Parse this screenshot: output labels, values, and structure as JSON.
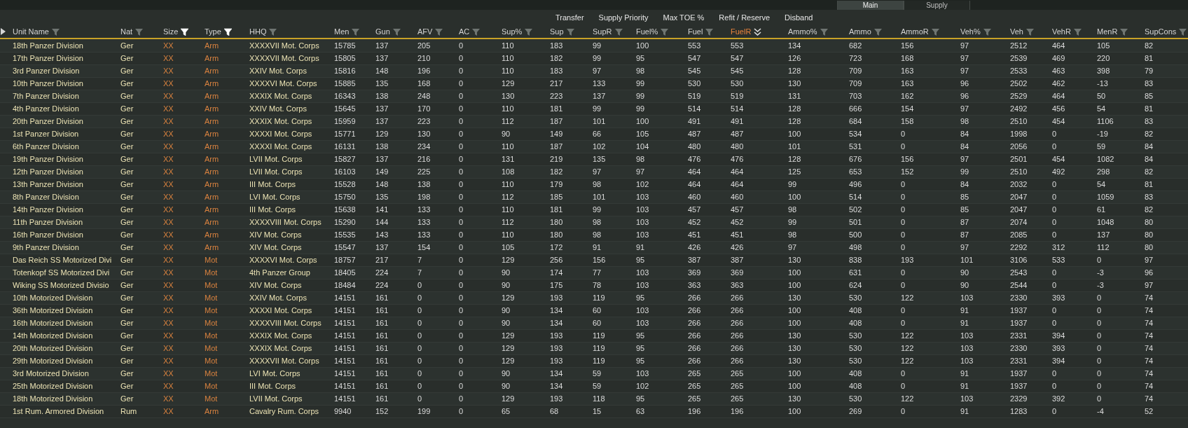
{
  "tabs": [
    {
      "label": "Main",
      "selected": true
    },
    {
      "label": "Supply",
      "selected": false
    }
  ],
  "actions": [
    "Transfer",
    "Supply Priority",
    "Max TOE %",
    "Refit / Reserve",
    "Disband"
  ],
  "columns": [
    {
      "label": "Unit Name",
      "kind": "name",
      "filter_active": false,
      "sorted": false
    },
    {
      "label": "Nat",
      "kind": "text",
      "filter_active": false,
      "sorted": false
    },
    {
      "label": "Size",
      "kind": "tag",
      "filter_active": true,
      "sorted": false
    },
    {
      "label": "Type",
      "kind": "tag",
      "filter_active": true,
      "sorted": false
    },
    {
      "label": "HHQ",
      "kind": "text",
      "filter_active": false,
      "sorted": false
    },
    {
      "label": "Men",
      "kind": "number",
      "filter_active": false,
      "sorted": false
    },
    {
      "label": "Gun",
      "kind": "number",
      "filter_active": false,
      "sorted": false
    },
    {
      "label": "AFV",
      "kind": "number",
      "filter_active": false,
      "sorted": false
    },
    {
      "label": "AC",
      "kind": "number",
      "filter_active": false,
      "sorted": false
    },
    {
      "label": "Sup%",
      "kind": "number",
      "filter_active": false,
      "sorted": false
    },
    {
      "label": "Sup",
      "kind": "number",
      "filter_active": false,
      "sorted": false
    },
    {
      "label": "SupR",
      "kind": "number",
      "filter_active": false,
      "sorted": false
    },
    {
      "label": "Fuel%",
      "kind": "number",
      "filter_active": false,
      "sorted": false
    },
    {
      "label": "Fuel",
      "kind": "number",
      "filter_active": false,
      "sorted": false
    },
    {
      "label": "FuelR",
      "kind": "number",
      "sorted": true
    },
    {
      "label": "Ammo%",
      "kind": "number",
      "filter_active": false,
      "sorted": false
    },
    {
      "label": "Ammo",
      "kind": "number",
      "filter_active": false,
      "sorted": false
    },
    {
      "label": "AmmoR",
      "kind": "number",
      "filter_active": false,
      "sorted": false
    },
    {
      "label": "Veh%",
      "kind": "number",
      "filter_active": false,
      "sorted": false
    },
    {
      "label": "Veh",
      "kind": "number",
      "filter_active": false,
      "sorted": false
    },
    {
      "label": "VehR",
      "kind": "number",
      "filter_active": false,
      "sorted": false
    },
    {
      "label": "MenR",
      "kind": "number",
      "filter_active": false,
      "sorted": false
    },
    {
      "label": "SupCons",
      "kind": "number",
      "filter_active": false,
      "sorted": false
    }
  ],
  "rows": [
    [
      "18th Panzer Division",
      "Ger",
      "XX",
      "Arm",
      "XXXXVII Mot. Corps",
      "15785",
      "137",
      "205",
      "0",
      "110",
      "183",
      "99",
      "100",
      "553",
      "553",
      "134",
      "682",
      "156",
      "97",
      "2512",
      "464",
      "105",
      "82"
    ],
    [
      "17th Panzer Division",
      "Ger",
      "XX",
      "Arm",
      "XXXXVII Mot. Corps",
      "15805",
      "137",
      "210",
      "0",
      "110",
      "182",
      "99",
      "95",
      "547",
      "547",
      "126",
      "723",
      "168",
      "97",
      "2539",
      "469",
      "220",
      "81"
    ],
    [
      "3rd Panzer Division",
      "Ger",
      "XX",
      "Arm",
      "XXIV Mot. Corps",
      "15816",
      "148",
      "196",
      "0",
      "110",
      "183",
      "97",
      "98",
      "545",
      "545",
      "128",
      "709",
      "163",
      "97",
      "2533",
      "463",
      "398",
      "79"
    ],
    [
      "10th Panzer Division",
      "Ger",
      "XX",
      "Arm",
      "XXXXVI Mot. Corps",
      "15885",
      "135",
      "168",
      "0",
      "129",
      "217",
      "133",
      "99",
      "530",
      "530",
      "130",
      "709",
      "163",
      "96",
      "2502",
      "462",
      "-13",
      "83"
    ],
    [
      "7th Panzer Division",
      "Ger",
      "XX",
      "Arm",
      "XXXIX Mot. Corps",
      "16343",
      "138",
      "248",
      "0",
      "130",
      "223",
      "137",
      "99",
      "519",
      "519",
      "131",
      "703",
      "162",
      "96",
      "2529",
      "464",
      "50",
      "85"
    ],
    [
      "4th Panzer Division",
      "Ger",
      "XX",
      "Arm",
      "XXIV Mot. Corps",
      "15645",
      "137",
      "170",
      "0",
      "110",
      "181",
      "99",
      "99",
      "514",
      "514",
      "128",
      "666",
      "154",
      "97",
      "2492",
      "456",
      "54",
      "81"
    ],
    [
      "20th Panzer Division",
      "Ger",
      "XX",
      "Arm",
      "XXXIX Mot. Corps",
      "15959",
      "137",
      "223",
      "0",
      "112",
      "187",
      "101",
      "100",
      "491",
      "491",
      "128",
      "684",
      "158",
      "98",
      "2510",
      "454",
      "1106",
      "83"
    ],
    [
      "1st Panzer Division",
      "Ger",
      "XX",
      "Arm",
      "XXXXI Mot. Corps",
      "15771",
      "129",
      "130",
      "0",
      "90",
      "149",
      "66",
      "105",
      "487",
      "487",
      "100",
      "534",
      "0",
      "84",
      "1998",
      "0",
      "-19",
      "82"
    ],
    [
      "6th Panzer Division",
      "Ger",
      "XX",
      "Arm",
      "XXXXI Mot. Corps",
      "16131",
      "138",
      "234",
      "0",
      "110",
      "187",
      "102",
      "104",
      "480",
      "480",
      "101",
      "531",
      "0",
      "84",
      "2056",
      "0",
      "59",
      "84"
    ],
    [
      "19th Panzer Division",
      "Ger",
      "XX",
      "Arm",
      "LVII Mot. Corps",
      "15827",
      "137",
      "216",
      "0",
      "131",
      "219",
      "135",
      "98",
      "476",
      "476",
      "128",
      "676",
      "156",
      "97",
      "2501",
      "454",
      "1082",
      "84"
    ],
    [
      "12th Panzer Division",
      "Ger",
      "XX",
      "Arm",
      "LVII Mot. Corps",
      "16103",
      "149",
      "225",
      "0",
      "108",
      "182",
      "97",
      "97",
      "464",
      "464",
      "125",
      "653",
      "152",
      "99",
      "2510",
      "492",
      "298",
      "82"
    ],
    [
      "13th Panzer Division",
      "Ger",
      "XX",
      "Arm",
      "III Mot. Corps",
      "15528",
      "148",
      "138",
      "0",
      "110",
      "179",
      "98",
      "102",
      "464",
      "464",
      "99",
      "496",
      "0",
      "84",
      "2032",
      "0",
      "54",
      "81"
    ],
    [
      "8th Panzer Division",
      "Ger",
      "XX",
      "Arm",
      "LVI Mot. Corps",
      "15750",
      "135",
      "198",
      "0",
      "112",
      "185",
      "101",
      "103",
      "460",
      "460",
      "100",
      "514",
      "0",
      "85",
      "2047",
      "0",
      "1059",
      "83"
    ],
    [
      "14th Panzer Division",
      "Ger",
      "XX",
      "Arm",
      "III Mot. Corps",
      "15638",
      "141",
      "133",
      "0",
      "110",
      "181",
      "99",
      "103",
      "457",
      "457",
      "98",
      "502",
      "0",
      "85",
      "2047",
      "0",
      "61",
      "82"
    ],
    [
      "11th Panzer Division",
      "Ger",
      "XX",
      "Arm",
      "XXXXVIII Mot. Corps",
      "15290",
      "144",
      "133",
      "0",
      "112",
      "180",
      "98",
      "103",
      "452",
      "452",
      "99",
      "501",
      "0",
      "87",
      "2074",
      "0",
      "1048",
      "80"
    ],
    [
      "16th Panzer Division",
      "Ger",
      "XX",
      "Arm",
      "XIV Mot. Corps",
      "15535",
      "143",
      "133",
      "0",
      "110",
      "180",
      "98",
      "103",
      "451",
      "451",
      "98",
      "500",
      "0",
      "87",
      "2085",
      "0",
      "137",
      "80"
    ],
    [
      "9th Panzer Division",
      "Ger",
      "XX",
      "Arm",
      "XIV Mot. Corps",
      "15547",
      "137",
      "154",
      "0",
      "105",
      "172",
      "91",
      "91",
      "426",
      "426",
      "97",
      "498",
      "0",
      "97",
      "2292",
      "312",
      "112",
      "80"
    ],
    [
      "Das Reich SS Motorized Divi",
      "Ger",
      "XX",
      "Mot",
      "XXXXVI Mot. Corps",
      "18757",
      "217",
      "7",
      "0",
      "129",
      "256",
      "156",
      "95",
      "387",
      "387",
      "130",
      "838",
      "193",
      "101",
      "3106",
      "533",
      "0",
      "97"
    ],
    [
      "Totenkopf SS Motorized Divi",
      "Ger",
      "XX",
      "Mot",
      "4th Panzer Group",
      "18405",
      "224",
      "7",
      "0",
      "90",
      "174",
      "77",
      "103",
      "369",
      "369",
      "100",
      "631",
      "0",
      "90",
      "2543",
      "0",
      "-3",
      "96"
    ],
    [
      "Wiking SS Motorized Divisio",
      "Ger",
      "XX",
      "Mot",
      "XIV Mot. Corps",
      "18484",
      "224",
      "0",
      "0",
      "90",
      "175",
      "78",
      "103",
      "363",
      "363",
      "100",
      "624",
      "0",
      "90",
      "2544",
      "0",
      "-3",
      "97"
    ],
    [
      "10th Motorized Division",
      "Ger",
      "XX",
      "Mot",
      "XXIV Mot. Corps",
      "14151",
      "161",
      "0",
      "0",
      "129",
      "193",
      "119",
      "95",
      "266",
      "266",
      "130",
      "530",
      "122",
      "103",
      "2330",
      "393",
      "0",
      "74"
    ],
    [
      "36th Motorized Division",
      "Ger",
      "XX",
      "Mot",
      "XXXXI Mot. Corps",
      "14151",
      "161",
      "0",
      "0",
      "90",
      "134",
      "60",
      "103",
      "266",
      "266",
      "100",
      "408",
      "0",
      "91",
      "1937",
      "0",
      "0",
      "74"
    ],
    [
      "16th Motorized Division",
      "Ger",
      "XX",
      "Mot",
      "XXXXVIII Mot. Corps",
      "14151",
      "161",
      "0",
      "0",
      "90",
      "134",
      "60",
      "103",
      "266",
      "266",
      "100",
      "408",
      "0",
      "91",
      "1937",
      "0",
      "0",
      "74"
    ],
    [
      "14th Motorized Division",
      "Ger",
      "XX",
      "Mot",
      "XXXIX Mot. Corps",
      "14151",
      "161",
      "0",
      "0",
      "129",
      "193",
      "119",
      "95",
      "266",
      "266",
      "130",
      "530",
      "122",
      "103",
      "2331",
      "394",
      "0",
      "74"
    ],
    [
      "20th Motorized Division",
      "Ger",
      "XX",
      "Mot",
      "XXXIX Mot. Corps",
      "14151",
      "161",
      "0",
      "0",
      "129",
      "193",
      "119",
      "95",
      "266",
      "266",
      "130",
      "530",
      "122",
      "103",
      "2330",
      "393",
      "0",
      "74"
    ],
    [
      "29th Motorized Division",
      "Ger",
      "XX",
      "Mot",
      "XXXXVII Mot. Corps",
      "14151",
      "161",
      "0",
      "0",
      "129",
      "193",
      "119",
      "95",
      "266",
      "266",
      "130",
      "530",
      "122",
      "103",
      "2331",
      "394",
      "0",
      "74"
    ],
    [
      "3rd Motorized Division",
      "Ger",
      "XX",
      "Mot",
      "LVI Mot. Corps",
      "14151",
      "161",
      "0",
      "0",
      "90",
      "134",
      "59",
      "103",
      "265",
      "265",
      "100",
      "408",
      "0",
      "91",
      "1937",
      "0",
      "0",
      "74"
    ],
    [
      "25th Motorized Division",
      "Ger",
      "XX",
      "Mot",
      "III Mot. Corps",
      "14151",
      "161",
      "0",
      "0",
      "90",
      "134",
      "59",
      "102",
      "265",
      "265",
      "100",
      "408",
      "0",
      "91",
      "1937",
      "0",
      "0",
      "74"
    ],
    [
      "18th Motorized Division",
      "Ger",
      "XX",
      "Mot",
      "LVII Mot. Corps",
      "14151",
      "161",
      "0",
      "0",
      "129",
      "193",
      "118",
      "95",
      "265",
      "265",
      "130",
      "530",
      "122",
      "103",
      "2329",
      "392",
      "0",
      "74"
    ],
    [
      "1st Rum. Armored Division",
      "Rum",
      "XX",
      "Arm",
      "Cavalry Rum. Corps",
      "9940",
      "152",
      "199",
      "0",
      "65",
      "68",
      "15",
      "63",
      "196",
      "196",
      "100",
      "269",
      "0",
      "91",
      "1283",
      "0",
      "-4",
      "52"
    ]
  ]
}
